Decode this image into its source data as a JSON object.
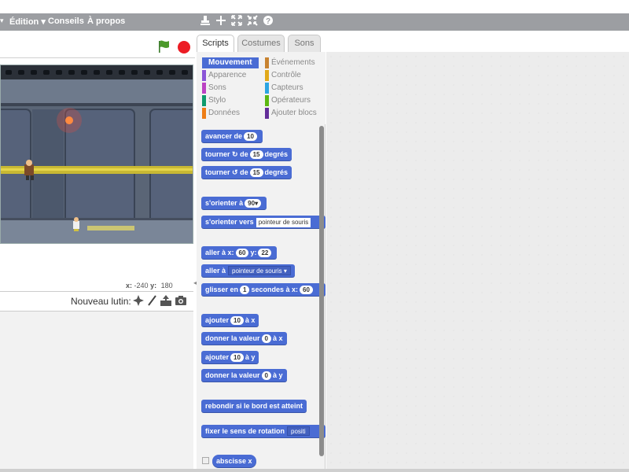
{
  "menu": {
    "edition": "Édition ▾",
    "conseils": "Conseils",
    "apropos": "À propos"
  },
  "stage": {
    "coords_x_label": "x:",
    "coords_x": "-240",
    "coords_y_label": "y:",
    "coords_y": "180",
    "new_sprite_label": "Nouveau lutin:"
  },
  "tabs": [
    "Scripts",
    "Costumes",
    "Sons"
  ],
  "categories": [
    {
      "label": "Mouvement",
      "color": "#4a6cd4"
    },
    {
      "label": "Apparence",
      "color": "#8a55d7"
    },
    {
      "label": "Sons",
      "color": "#bb42c3"
    },
    {
      "label": "Stylo",
      "color": "#0e9a6c"
    },
    {
      "label": "Données",
      "color": "#ee7d16"
    },
    {
      "label": "Événements",
      "color": "#c88330"
    },
    {
      "label": "Contrôle",
      "color": "#e1a91a"
    },
    {
      "label": "Capteurs",
      "color": "#2ca5e2"
    },
    {
      "label": "Opérateurs",
      "color": "#5cb712"
    },
    {
      "label": "Ajouter blocs",
      "color": "#632d99"
    }
  ],
  "blocks": {
    "avancer": {
      "label": "avancer de",
      "value": "10"
    },
    "tourner_droite": {
      "a": "tourner",
      "b": "de",
      "value": "15",
      "c": "degrés"
    },
    "tourner_gauche": {
      "a": "tourner",
      "b": "de",
      "value": "15",
      "c": "degrés"
    },
    "orienter": {
      "label": "s'orienter à",
      "value": "90▾"
    },
    "orienter_vers": {
      "label": "s'orienter vers",
      "value": "pointeur de souris"
    },
    "aller_xy": {
      "a": "aller à x:",
      "x": "60",
      "b": "y:",
      "y": "22"
    },
    "aller_a": {
      "label": "aller à",
      "value": "pointeur de souris ▾"
    },
    "glisser": {
      "a": "glisser en",
      "value": "1",
      "b": "secondes à x:",
      "x": "60"
    },
    "ajouter_x": {
      "a": "ajouter",
      "value": "10",
      "b": "à x"
    },
    "donner_x": {
      "a": "donner la valeur",
      "value": "0",
      "b": "à x"
    },
    "ajouter_y": {
      "a": "ajouter",
      "value": "10",
      "b": "à y"
    },
    "donner_y": {
      "a": "donner la valeur",
      "value": "0",
      "b": "à y"
    },
    "rebondir": {
      "label": "rebondir si le bord est atteint"
    },
    "rotation": {
      "label": "fixer le sens de rotation",
      "value": "positi"
    },
    "abscisse": {
      "label": "abscisse x"
    }
  }
}
